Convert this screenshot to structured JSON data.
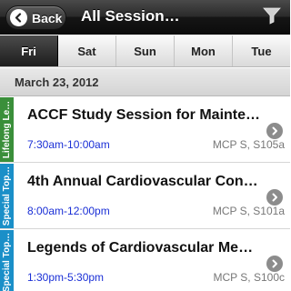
{
  "header": {
    "back_label": "Back",
    "title": "All Session…"
  },
  "tabs": [
    {
      "label": "Fri",
      "active": true
    },
    {
      "label": "Sat",
      "active": false
    },
    {
      "label": "Sun",
      "active": false
    },
    {
      "label": "Mon",
      "active": false
    },
    {
      "label": "Tue",
      "active": false
    }
  ],
  "date_header": "March 23, 2012",
  "sessions": [
    {
      "category": "Lifelong Le…",
      "category_color": "#3a8f3a",
      "title": "ACCF Study Session for Mainte…",
      "time": "7:30am-10:00am",
      "room": "MCP S, S105a"
    },
    {
      "category": "Special Top…",
      "category_color": "#1a8fc8",
      "title": "4th Annual Cardiovascular Con…",
      "time": "8:00am-12:00pm",
      "room": "MCP S, S101a"
    },
    {
      "category": "Special Top…",
      "category_color": "#1a8fc8",
      "title": "Legends of Cardiovascular Me…",
      "time": "1:30pm-5:30pm",
      "room": "MCP S, S100c"
    }
  ],
  "colors": {
    "time_text": "#1a2fd6",
    "header_bg": "#1b1b1b"
  },
  "icons": {
    "back": "arrow-left-icon",
    "filter": "filter-funnel-icon",
    "row": "chevron-right-icon"
  }
}
